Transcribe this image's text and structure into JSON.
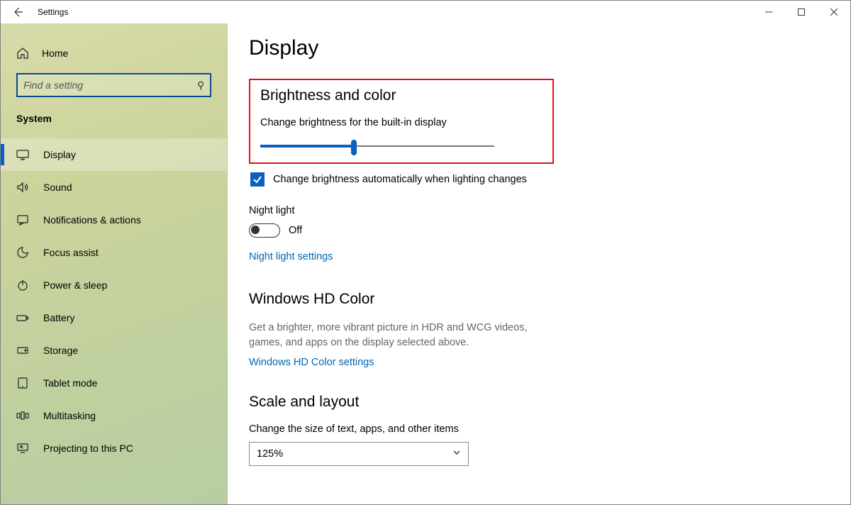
{
  "titlebar": {
    "app_title": "Settings"
  },
  "sidebar": {
    "home_label": "Home",
    "search_placeholder": "Find a setting",
    "category_label": "System",
    "items": [
      {
        "label": "Display"
      },
      {
        "label": "Sound"
      },
      {
        "label": "Notifications & actions"
      },
      {
        "label": "Focus assist"
      },
      {
        "label": "Power & sleep"
      },
      {
        "label": "Battery"
      },
      {
        "label": "Storage"
      },
      {
        "label": "Tablet mode"
      },
      {
        "label": "Multitasking"
      },
      {
        "label": "Projecting to this PC"
      }
    ]
  },
  "content": {
    "page_title": "Display",
    "brightness_section": "Brightness and color",
    "brightness_label": "Change brightness for the built-in display",
    "brightness_value_percent": 40,
    "auto_brightness_label": "Change brightness automatically when lighting changes",
    "auto_brightness_checked": true,
    "night_light_label": "Night light",
    "night_light_state": "Off",
    "night_light_link": "Night light settings",
    "hd_color_section": "Windows HD Color",
    "hd_color_help": "Get a brighter, more vibrant picture in HDR and WCG videos, games, and apps on the display selected above.",
    "hd_color_link": "Windows HD Color settings",
    "scale_section": "Scale and layout",
    "scale_label": "Change the size of text, apps, and other items",
    "scale_value": "125%"
  }
}
